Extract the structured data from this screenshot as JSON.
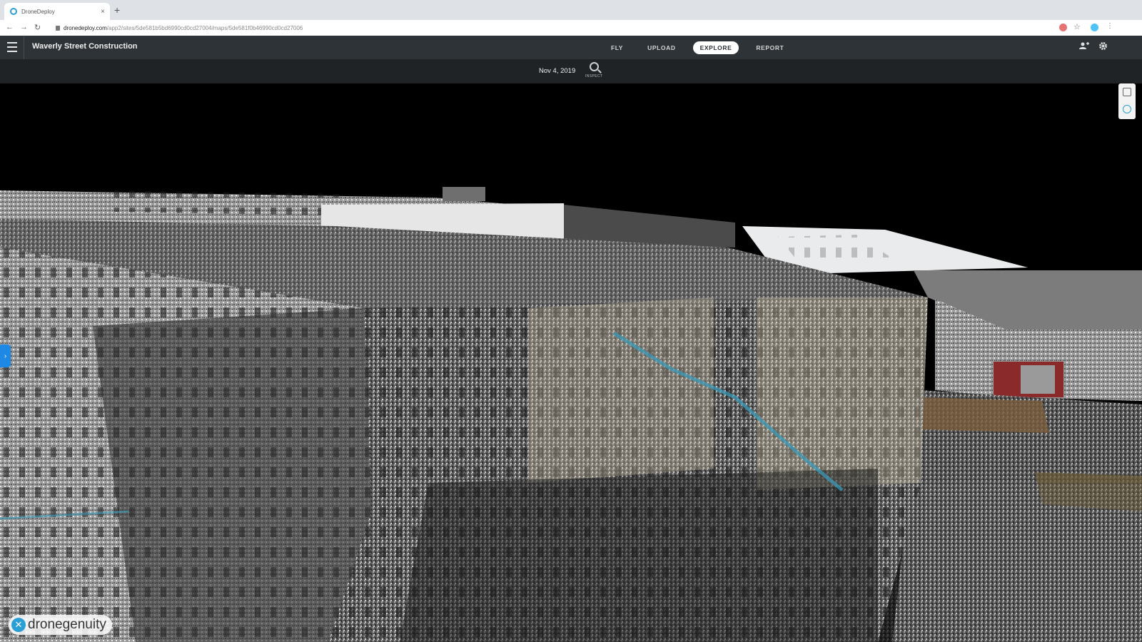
{
  "browser": {
    "tab_title": "DroneDeploy",
    "tab_close": "×",
    "new_tab": "+",
    "url_host": "dronedeploy.com",
    "url_path": "/app2/sites/5de581b5bd6990cd0cd27004/maps/5de581f0b46990cd0cd27006",
    "nav_back": "←",
    "nav_forward": "→",
    "nav_reload": "↻",
    "bookmark": "☆"
  },
  "app": {
    "project_title": "Waverly Street Construction",
    "tabs": [
      {
        "label": "FLY"
      },
      {
        "label": "UPLOAD"
      },
      {
        "label": "EXPLORE"
      },
      {
        "label": "REPORT"
      }
    ],
    "active_tab": "EXPLORE"
  },
  "datebar": {
    "date": "Nov 4, 2019",
    "inspect_label": "INSPECT"
  },
  "viewport": {
    "side_toggle": "›"
  },
  "watermark": {
    "brand": "dronegenuity",
    "mark": "✕"
  },
  "colors": {
    "accent": "#1e88e5",
    "header_bg": "#2d3337",
    "datebar_bg": "#1f2326"
  }
}
